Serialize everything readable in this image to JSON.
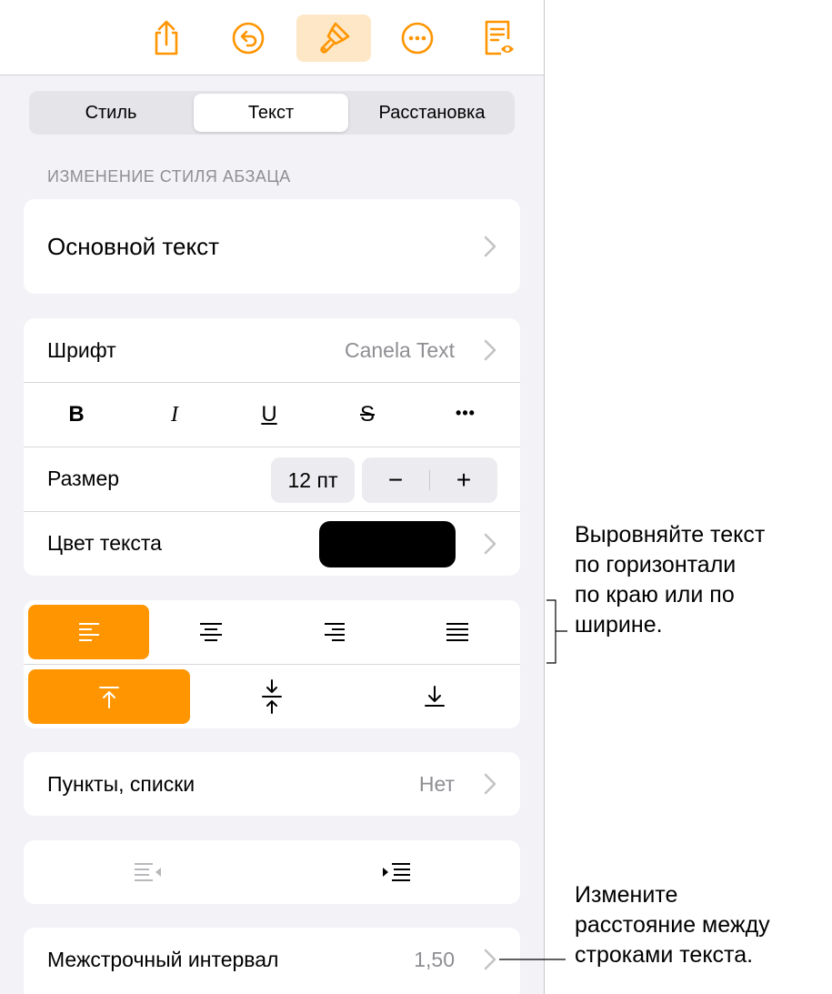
{
  "toolbar": {
    "icons": [
      "share-icon",
      "undo-icon",
      "format-brush-icon",
      "more-icon",
      "reader-view-icon"
    ],
    "accent_color": "#ff9500",
    "active_tint": "#fde7c6"
  },
  "tabs": [
    {
      "label": "Стиль"
    },
    {
      "label": "Текст"
    },
    {
      "label": "Расстановка"
    }
  ],
  "selected_tab": "Текст",
  "section_header": "ИЗМЕНЕНИЕ СТИЛЯ АБЗАЦА",
  "paragraph_style": {
    "label": "Основной текст"
  },
  "font": {
    "label": "Шрифт",
    "value": "Canela Text"
  },
  "format_buttons": {
    "bold": "B",
    "italic": "I",
    "underline": "U",
    "strike": "S",
    "more": "•••"
  },
  "size": {
    "label": "Размер",
    "value": "12 пт",
    "decrease": "−",
    "increase": "+"
  },
  "text_color": {
    "label": "Цвет текста",
    "swatch": "#000000"
  },
  "horizontal_alignment": {
    "options": [
      "left",
      "center",
      "right",
      "justify"
    ],
    "selected": "left"
  },
  "vertical_alignment": {
    "options": [
      "top",
      "middle",
      "bottom"
    ],
    "selected": "top"
  },
  "bullets": {
    "label": "Пункты, списки",
    "value": "Нет"
  },
  "indent": {
    "options": [
      "decrease-indent-icon",
      "increase-indent-icon"
    ]
  },
  "line_spacing": {
    "label": "Межстрочный интервал",
    "value": "1,50"
  },
  "callouts": {
    "alignment": [
      "Выровняйте текст",
      "по горизонтали",
      "по краю или по",
      "ширине."
    ],
    "spacing": [
      "Измените",
      "расстояние между",
      "строками текста."
    ]
  }
}
